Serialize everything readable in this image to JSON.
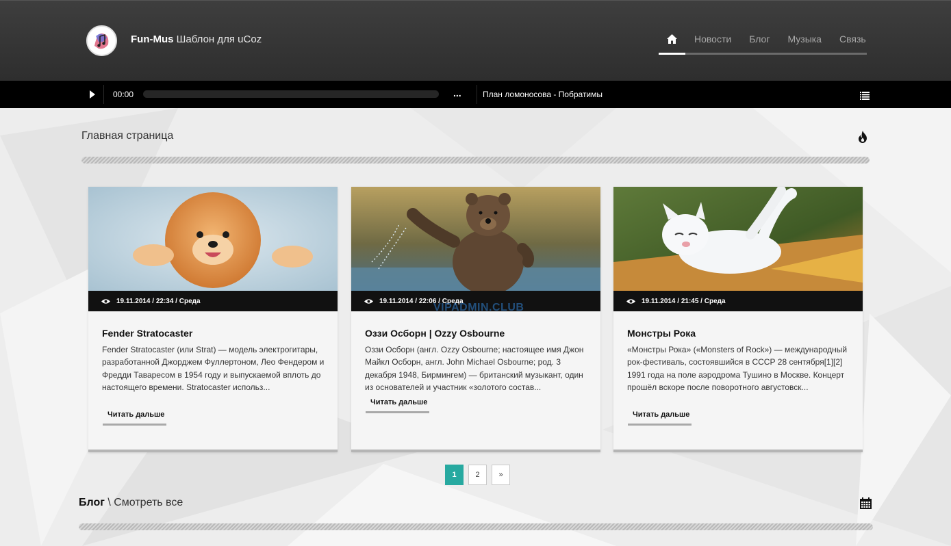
{
  "header": {
    "brand": "Fun-Mus",
    "subtitle": "Шаблон для uCoz",
    "nav": [
      {
        "label": "Новости"
      },
      {
        "label": "Блог"
      },
      {
        "label": "Музыка"
      },
      {
        "label": "Связь"
      }
    ]
  },
  "player": {
    "time": "00:00",
    "more": "...",
    "track": "План ломоносова - Побратимы"
  },
  "main": {
    "title": "Главная страница"
  },
  "cards": [
    {
      "date": "19.11.2014 / 22:34 / Среда",
      "title": "Fender Stratocaster",
      "text": "Fender Stratocaster (или Strat) — модель электрогитары, разработанной Джорджем Фуллертоном, Лео Фендером и Фредди Таваресом в 1954 году и выпускаемой вплоть до настоящего времени. Stratocaster использ...",
      "more": "Читать дальше"
    },
    {
      "date": "19.11.2014 / 22:06 / Среда",
      "title": "Оззи Осборн | Ozzy Osbourne",
      "text": "Оззи Осборн (англ. Ozzy Osbourne; настоящее имя Джон Майкл Осборн, англ. John Michael Osbourne; род. 3 декабря 1948, Бирмингем) — британский музыкант, один из основателей и участник «золотого состав...",
      "more": "Читать дальше"
    },
    {
      "date": "19.11.2014 / 21:45 / Среда",
      "title": "Монстры Рока",
      "text": "«Монстры Рока» («Monsters of Rock») — международный рок-фестиваль, состоявшийся в СССР 28 сентября[1][2] 1991 года на поле аэродрома Тушино в Москве. Концерт прошёл вскоре после поворотного августовск...",
      "more": "Читать дальше"
    }
  ],
  "pagination": [
    "1",
    "2",
    "»"
  ],
  "blog": {
    "title": "Блог",
    "sep": "\\",
    "link": "Смотреть все"
  },
  "watermark": "VIPADMIN.CLUB"
}
